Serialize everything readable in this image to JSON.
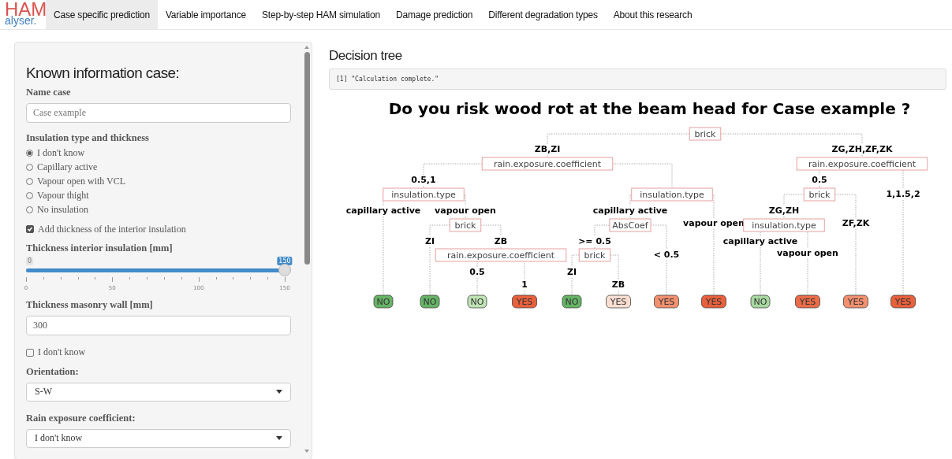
{
  "logo": {
    "top": "HAM",
    "bottom": "alyser."
  },
  "tabs": [
    {
      "label": "Case specific prediction",
      "selected": true
    },
    {
      "label": "Variable importance",
      "selected": false
    },
    {
      "label": "Step-by-step HAM simulation",
      "selected": false
    },
    {
      "label": "Damage prediction",
      "selected": false
    },
    {
      "label": "Different degradation types",
      "selected": false
    },
    {
      "label": "About this research",
      "selected": false
    }
  ],
  "sidebar": {
    "heading": "Known information case:",
    "name_case": {
      "label": "Name case",
      "placeholder": "Case example"
    },
    "insulation": {
      "label": "Insulation type and thickness",
      "options": [
        {
          "label": "I don't know",
          "selected": true
        },
        {
          "label": "Capillary active",
          "selected": false
        },
        {
          "label": "Vapour open with VCL",
          "selected": false
        },
        {
          "label": "Vapour thight",
          "selected": false
        },
        {
          "label": "No insulation",
          "selected": false
        }
      ]
    },
    "add_interior": {
      "label": "Add thickness of the interior insulation",
      "checked": true
    },
    "interior_slider": {
      "label": "Thickness interior insulation [mm]",
      "min_label": "0",
      "value_label": "150",
      "level": 1,
      "ticks": [
        "0",
        "50",
        "100",
        "150"
      ]
    },
    "masonry": {
      "label": "Thickness masonry wall [mm]",
      "value": "300"
    },
    "masonry_unknown": {
      "label": "I don't know",
      "checked": false
    },
    "orientation": {
      "label": "Orientation:",
      "value": "S-W"
    },
    "rain": {
      "label": "Rain exposure coefficient:",
      "value": "I don't know"
    }
  },
  "main": {
    "heading": "Decision tree",
    "output": "[1] \"Calculation complete.\"",
    "title": "Do you risk wood rot at the beam head for Case example ?",
    "tree": {
      "kind": "split",
      "label": "brick",
      "children": [
        {
          "edge": "ZB,ZI",
          "kind": "split",
          "label": "rain.exposure.coefficient",
          "children": [
            {
              "edge": "0.5,1",
              "kind": "split",
              "label": "insulation.type",
              "children": [
                {
                  "edge": "capillary active",
                  "kind": "leaf",
                  "label": "NO",
                  "color": "#66b366"
                },
                {
                  "edge": "vapour open",
                  "kind": "split",
                  "label": "brick",
                  "children": [
                    {
                      "edge": "ZI",
                      "kind": "leaf",
                      "label": "NO",
                      "color": "#66b366"
                    },
                    {
                      "edge": "ZB",
                      "kind": "split",
                      "label": "rain.exposure.coefficient",
                      "children": [
                        {
                          "edge": "0.5",
                          "kind": "leaf",
                          "label": "NO",
                          "color": "#bfe3b4"
                        },
                        {
                          "edge": "1",
                          "kind": "leaf",
                          "label": "YES",
                          "color": "#e8603c"
                        }
                      ]
                    }
                  ]
                }
              ]
            },
            {
              "kind": "split",
              "label": "insulation.type",
              "children": [
                {
                  "edge": "capillary active",
                  "kind": "split",
                  "label": "AbsCoef",
                  "children": [
                    {
                      "edge": ">= 0.5",
                      "kind": "split",
                      "label": "brick",
                      "children": [
                        {
                          "edge": "ZI",
                          "kind": "leaf",
                          "label": "NO",
                          "color": "#66b366"
                        },
                        {
                          "edge": "ZB",
                          "kind": "leaf",
                          "label": "YES",
                          "color": "#fbded2"
                        }
                      ]
                    },
                    {
                      "edge": "< 0.5",
                      "kind": "leaf",
                      "label": "YES",
                      "color": "#f2906f"
                    }
                  ]
                },
                {
                  "edge": "vapour open",
                  "kind": "leaf",
                  "label": "YES",
                  "color": "#e8603c"
                }
              ]
            }
          ]
        },
        {
          "edge": "ZG,ZH,ZF,ZK",
          "kind": "split",
          "label": "rain.exposure.coefficient",
          "children": [
            {
              "edge": "0.5",
              "kind": "split",
              "label": "brick",
              "children": [
                {
                  "edge": "ZG,ZH",
                  "kind": "split",
                  "label": "insulation.type",
                  "children": [
                    {
                      "edge": "capillary active",
                      "kind": "leaf",
                      "label": "NO",
                      "color": "#a8d8a0"
                    },
                    {
                      "edge": "vapour open",
                      "kind": "leaf",
                      "label": "YES",
                      "color": "#eb6c48"
                    }
                  ]
                },
                {
                  "edge": "ZF,ZK",
                  "kind": "leaf",
                  "label": "YES",
                  "color": "#f2906f"
                }
              ]
            },
            {
              "edge": "1,1.5,2",
              "kind": "leaf",
              "label": "YES",
              "color": "#e8603c"
            }
          ]
        }
      ]
    }
  }
}
